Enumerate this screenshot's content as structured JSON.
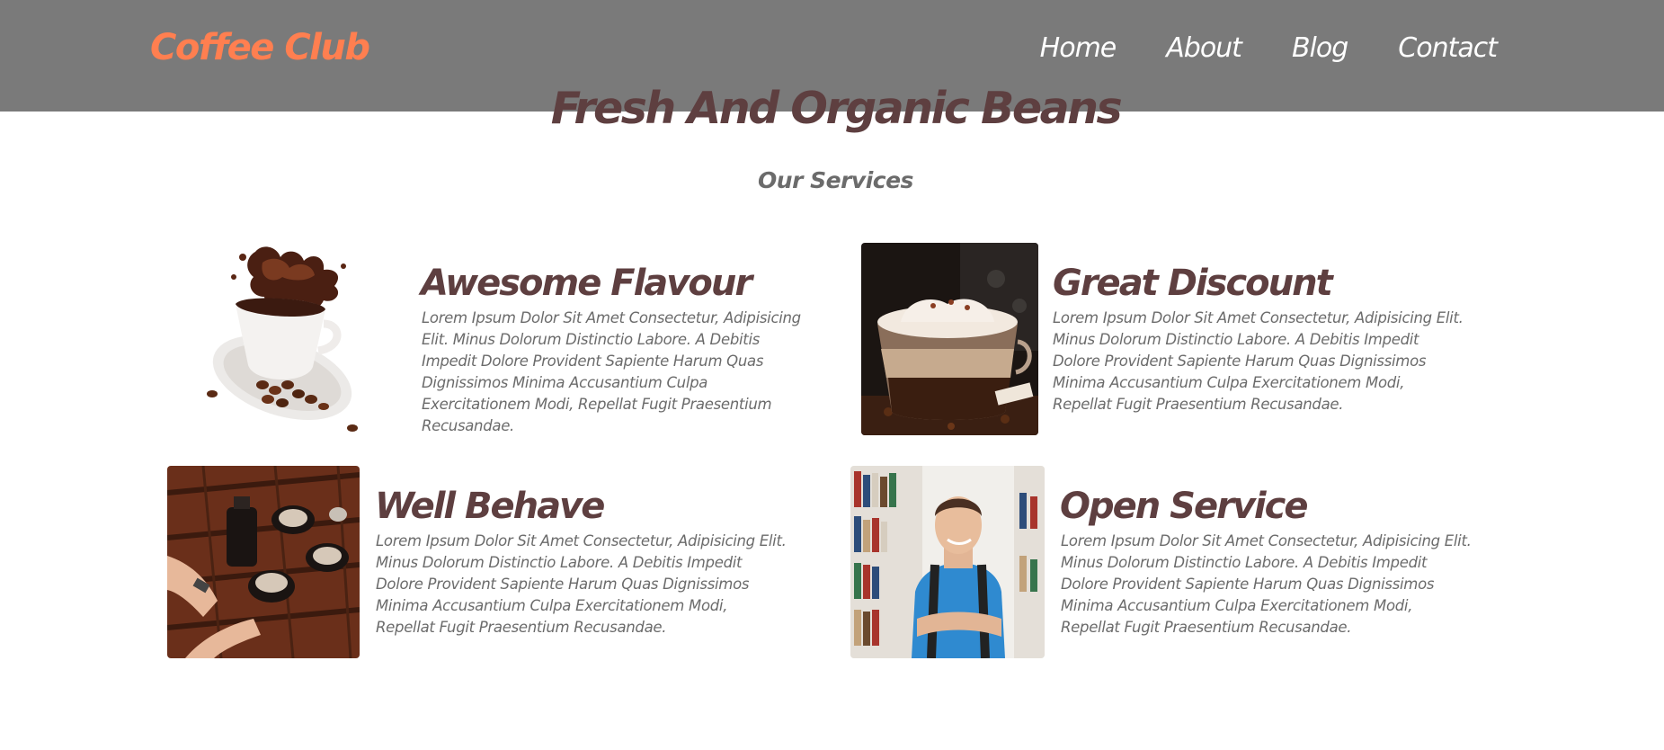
{
  "navbar": {
    "brand": "Coffee Club",
    "links": [
      {
        "label": "Home"
      },
      {
        "label": "About"
      },
      {
        "label": "Blog"
      },
      {
        "label": "Contact"
      }
    ]
  },
  "hero": {
    "title": "Fresh And Organic Beans"
  },
  "services": {
    "subtitle": "Our Services",
    "cards": [
      {
        "title": "Awesome Flavour",
        "text": "Lorem Ipsum Dolor Sit Amet Consectetur, Adipisicing Elit. Minus Dolorum Distinctio Labore. A Debitis Impedit Dolore Provident Sapiente Harum Quas Dignissimos Minima Accusantium Culpa Exercitationem Modi, Repellat Fugit Praesentium Recusandae.",
        "image": "coffee-splash-cup"
      },
      {
        "title": "Great Discount",
        "text": "Lorem Ipsum Dolor Sit Amet Consectetur, Adipisicing Elit. Minus Dolorum Distinctio Labore. A Debitis Impedit Dolore Provident Sapiente Harum Quas Dignissimos Minima Accusantium Culpa Exercitationem Modi, Repellat Fugit Praesentium Recusandae.",
        "image": "latte-glass"
      },
      {
        "title": "Well Behave",
        "text": "Lorem Ipsum Dolor Sit Amet Consectetur, Adipisicing Elit. Minus Dolorum Distinctio Labore. A Debitis Impedit Dolore Provident Sapiente Harum Quas Dignissimos Minima Accusantium Culpa Exercitationem Modi, Repellat Fugit Praesentium Recusandae.",
        "image": "coffee-table-cups"
      },
      {
        "title": "Open Service",
        "text": "Lorem Ipsum Dolor Sit Amet Consectetur, Adipisicing Elit. Minus Dolorum Distinctio Labore. A Debitis Impedit Dolore Provident Sapiente Harum Quas Dignissimos Minima Accusantium Culpa Exercitationem Modi, Repellat Fugit Praesentium Recusandae.",
        "image": "student-in-library"
      }
    ]
  },
  "colors": {
    "brand": "#ff7f50",
    "heading": "#5e3f40",
    "body_text": "#6b6b6b",
    "navbar": "#646464"
  }
}
